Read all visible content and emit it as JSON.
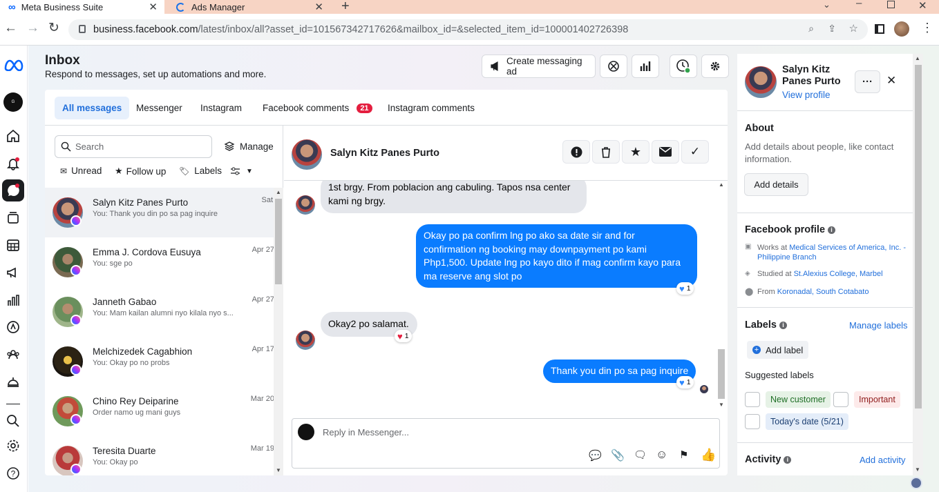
{
  "browser": {
    "tabs": [
      {
        "title": "Meta Business Suite"
      },
      {
        "title": "Ads Manager"
      }
    ],
    "url_host": "business.facebook.com",
    "url_path": "/latest/inbox/all?asset_id=101567342717626&mailbox_id=&selected_item_id=100001402726398"
  },
  "header": {
    "title": "Inbox",
    "subtitle": "Respond to messages, set up automations and more.",
    "create_ad_label": "Create messaging ad"
  },
  "filter_tabs": [
    {
      "label": "All messages"
    },
    {
      "label": "Messenger"
    },
    {
      "label": "Instagram"
    },
    {
      "label": "Facebook comments",
      "badge": "21"
    },
    {
      "label": "Instagram comments"
    }
  ],
  "search": {
    "placeholder": "Search",
    "manage_label": "Manage"
  },
  "filters": {
    "unread": "Unread",
    "follow_up": "Follow up",
    "labels": "Labels"
  },
  "conversations": [
    {
      "name": "Salyn Kitz Panes Purto",
      "preview": "You: Thank you din po sa pag inquire",
      "date": "Sat"
    },
    {
      "name": "Emma J. Cordova Eusuya",
      "preview": "You: sge po",
      "date": "Apr 27"
    },
    {
      "name": "Janneth Gabao",
      "preview": "You: Mam kailan alumni nyo kilala nyo s...",
      "date": "Apr 27"
    },
    {
      "name": "Melchizedek Cagabhion",
      "preview": "You: Okay po no probs",
      "date": "Apr 17"
    },
    {
      "name": "Chino Rey Deiparine",
      "preview": "Order namo ug mani guys",
      "date": "Mar 20"
    },
    {
      "name": "Teresita Duarte",
      "preview": "You: Okay po",
      "date": "Mar 19"
    }
  ],
  "thread": {
    "name": "Salyn Kitz Panes Purto",
    "messages": [
      {
        "dir": "in",
        "text": "1st brgy. From poblacion ang cabuling. Tapos nsa center kami ng brgy."
      },
      {
        "dir": "out",
        "text": "Okay po pa confirm lng po ako sa date sir and for confirmation ng booking may downpayment po kami Php1,500. Update lng po kayo dito if mag confirm kayo para ma reserve ang slot po",
        "reaction": "1"
      },
      {
        "dir": "in",
        "text": "Okay2 po salamat.",
        "reaction": "1"
      },
      {
        "dir": "out",
        "text": "Thank you din po sa pag inquire",
        "reaction": "1"
      }
    ],
    "reply_placeholder": "Reply in Messenger..."
  },
  "profile": {
    "name": "Salyn Kitz Panes Purto",
    "view_profile": "View profile",
    "about_title": "About",
    "about_text": "Add details about people, like contact information.",
    "add_details": "Add details",
    "fb_profile_title": "Facebook profile",
    "work_prefix": "Works at ",
    "work_place": "Medical Services of America, Inc. - Philippine Branch",
    "study_prefix": "Studied at ",
    "study_place": "St.Alexius College, Marbel",
    "from_prefix": "From ",
    "from_place": "Koronadal, South Cotabato",
    "labels_title": "Labels",
    "manage_labels": "Manage labels",
    "add_label": "Add label",
    "suggested_title": "Suggested labels",
    "suggested": [
      "New customer",
      "Important",
      "Today's date (5/21)"
    ],
    "activity_title": "Activity",
    "add_activity": "Add activity"
  },
  "colors": {
    "accent": "#0a7cff",
    "link": "#216fdb",
    "badge": "#e41e3f"
  }
}
